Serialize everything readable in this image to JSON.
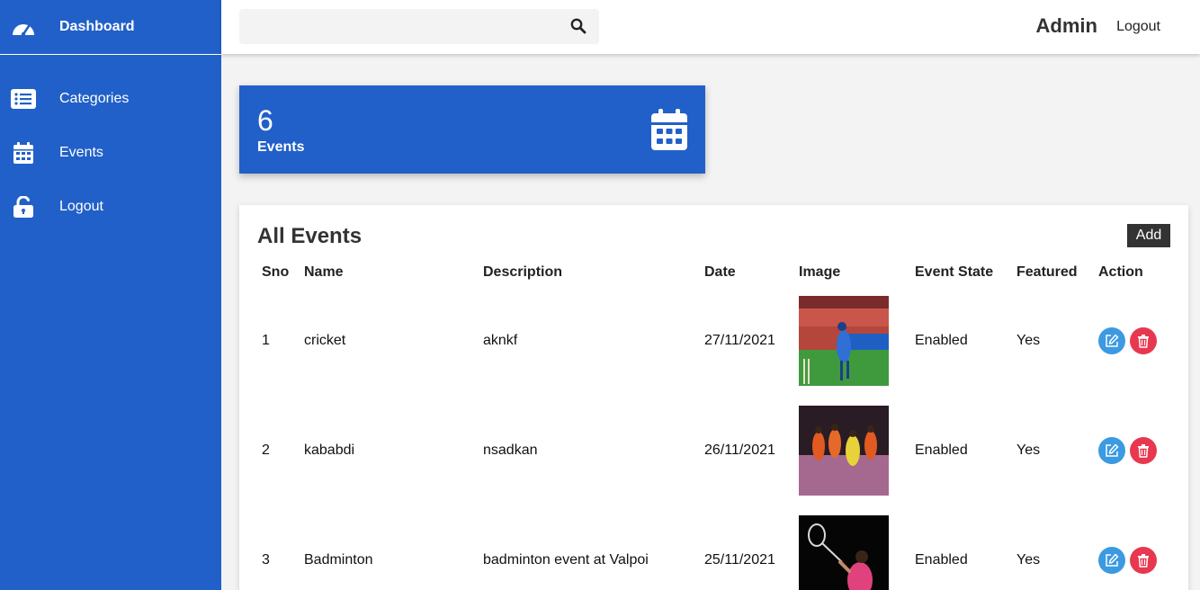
{
  "sidebar": {
    "brand": "Dashboard",
    "items": [
      {
        "label": "Categories",
        "icon": "list-icon"
      },
      {
        "label": "Events",
        "icon": "calendar-icon"
      },
      {
        "label": "Logout",
        "icon": "unlock-icon"
      }
    ]
  },
  "topbar": {
    "search_placeholder": "",
    "admin": "Admin",
    "logout": "Logout"
  },
  "stat": {
    "count": "6",
    "label": "Events"
  },
  "panel": {
    "title": "All Events",
    "add_label": "Add",
    "headers": [
      "Sno",
      "Name",
      "Description",
      "Date",
      "Image",
      "Event State",
      "Featured",
      "Action"
    ],
    "rows": [
      {
        "sno": "1",
        "name": "cricket",
        "description": "aknkf",
        "date": "27/11/2021",
        "state": "Enabled",
        "featured": "Yes"
      },
      {
        "sno": "2",
        "name": "kababdi",
        "description": "nsadkan",
        "date": "26/11/2021",
        "state": "Enabled",
        "featured": "Yes"
      },
      {
        "sno": "3",
        "name": "Badminton",
        "description": "badminton event at Valpoi",
        "date": "25/11/2021",
        "state": "Enabled",
        "featured": "Yes"
      }
    ]
  },
  "colors": {
    "primary": "#2160c8",
    "edit": "#3b9ae1",
    "delete": "#e8384f",
    "add_button": "#333333"
  }
}
